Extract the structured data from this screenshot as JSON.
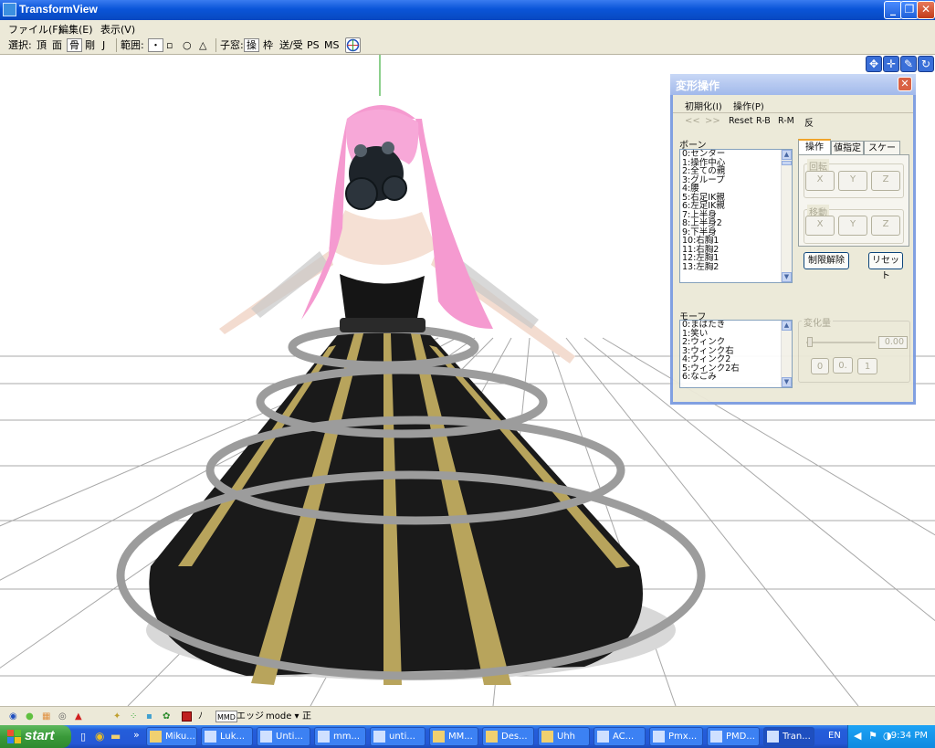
{
  "window": {
    "title": "TransformView"
  },
  "menu": [
    "ファイル(F)",
    "編集(E)",
    "表示(V)"
  ],
  "toolbar": {
    "select_label": "選択:",
    "select_items": [
      "頂",
      "面",
      "骨",
      "剛",
      "J"
    ],
    "range_label": "範囲:",
    "range_items": [
      "・",
      "▫",
      "○",
      "△"
    ],
    "child_label": "子窓:",
    "child_items": [
      "操",
      "枠",
      "送/受",
      "PS",
      "MS"
    ]
  },
  "dialog": {
    "title": "変形操作",
    "menu": [
      "初期化(I)",
      "操作(P)"
    ],
    "nav": {
      "prev": "<<",
      "next": ">>",
      "reset": "Reset",
      "rb": "R-B",
      "rm": "R-M",
      "flip": "反"
    },
    "bone_label": "ボーン",
    "bones": [
      "0:センター",
      "1:操作中心",
      "2:全ての親",
      "3:グループ",
      "4:腰",
      "5:右足IK親",
      "6:左足IK親",
      "7:上半身",
      "8:上半身2",
      "9:下半身",
      "10:右胸1",
      "11:右胸2",
      "12:左胸1",
      "13:左胸2"
    ],
    "tabs": [
      "操作",
      "値指定",
      "スケール"
    ],
    "rotate_label": "回転",
    "move_label": "移動",
    "axes": [
      "X",
      "Y",
      "Z"
    ],
    "limit_release": "制限解除",
    "reset": "リセット",
    "morph_label": "モーフ",
    "morphs": [
      "0:まばたき",
      "1:笑い",
      "2:ウィンク",
      "3:ウィンク右",
      "4:ウィンク2",
      "5:ウィンク2右",
      "6:なごみ"
    ],
    "amount_label": "変化量",
    "amount_value": "0.00",
    "presets": [
      "0",
      "0.",
      "1"
    ]
  },
  "statusbar": {
    "edge_label": "エッジ",
    "mode_label": "mode ▾",
    "positive_label": "正"
  },
  "taskbar": {
    "start": "start",
    "tasks": [
      "Miku...",
      "Luk...",
      "Unti...",
      "mm...",
      "unti...",
      "MM...",
      "Des...",
      "Uhh",
      "AC...",
      "Pmx...",
      "PMD...",
      "Tran..."
    ],
    "lang": "EN",
    "clock": "9:34 PM"
  },
  "colors": {
    "titlebar": "#0a55d8",
    "panel": "#ece9d8",
    "dress_black": "#1a1a1a",
    "dress_gold": "#b8a45c",
    "ring_gray": "#9a9a9a",
    "hair_pink": "#f59ad0"
  }
}
